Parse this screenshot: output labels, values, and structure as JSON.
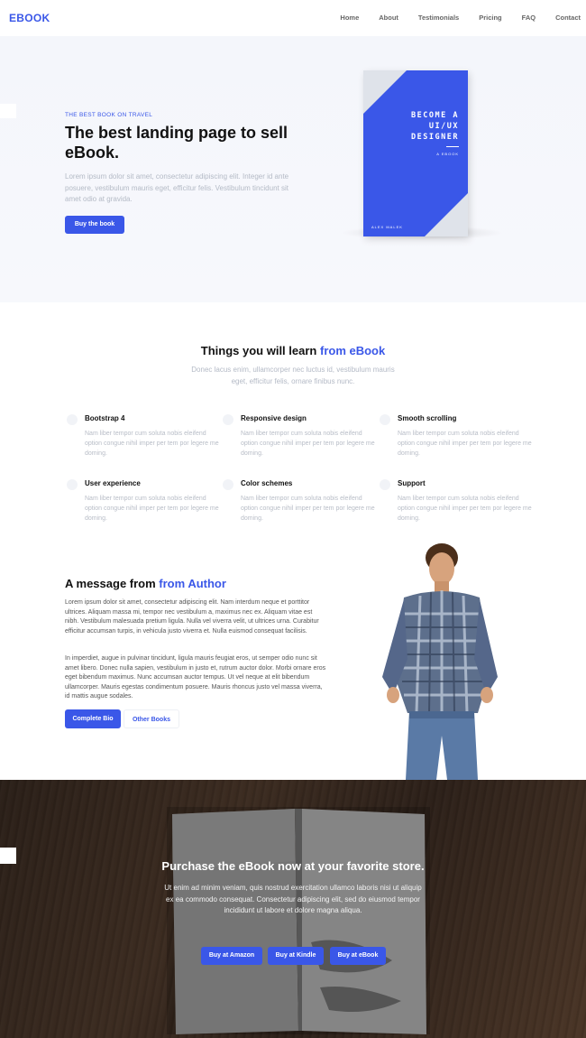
{
  "brand": {
    "logo": "EBOOK",
    "accent": "#3a57e8"
  },
  "nav": [
    "Home",
    "About",
    "Testimonials",
    "Pricing",
    "FAQ",
    "Contact"
  ],
  "hero": {
    "kicker": "THE BEST BOOK ON TRAVEL",
    "title": "The best landing page to sell eBook.",
    "text": "Lorem ipsum dolor sit amet, consectetur adipiscing elit. Integer id ante posuere, vestibulum mauris eget, efficitur felis. Vestibulum tincidunt sit amet odio at gravida.",
    "button": "Buy the book",
    "book": {
      "title": "BECOME A UI/UX DESIGNER",
      "subtitle": "A EBOOK",
      "author": "ALEX MALEK"
    }
  },
  "learn": {
    "title_prefix": "Things you will learn",
    "title_accent": "from eBook",
    "subtitle": "Donec lacus enim, ullamcorper nec luctus id, vestibulum mauris eget, efficitur felis, ornare finibus nunc.",
    "features": [
      {
        "title": "Bootstrap 4",
        "text": "Nam liber tempor cum soluta nobis eleifend option congue nihil imper per tem por legere me doming."
      },
      {
        "title": "Responsive design",
        "text": "Nam liber tempor cum soluta nobis eleifend option congue nihil imper per tem por legere me doming."
      },
      {
        "title": "Smooth scrolling",
        "text": "Nam liber tempor cum soluta nobis eleifend option congue nihil imper per tem por legere me doming."
      },
      {
        "title": "User experience",
        "text": "Nam liber tempor cum soluta nobis eleifend option congue nihil imper per tem por legere me doming."
      },
      {
        "title": "Color schemes",
        "text": "Nam liber tempor cum soluta nobis eleifend option congue nihil imper per tem por legere me doming."
      },
      {
        "title": "Support",
        "text": "Nam liber tempor cum soluta nobis eleifend option congue nihil imper per tem por legere me doming."
      }
    ]
  },
  "author": {
    "title_prefix": "A message from",
    "title_accent": "from Author",
    "paragraph1": "Lorem ipsum dolor sit amet, consectetur adipiscing elit. Nam interdum neque et porttitor ultrices. Aliquam massa mi, tempor nec vestibulum a, maximus nec ex. Aliquam vitae est nibh. Vestibulum malesuada pretium ligula. Nulla vel viverra velit, ut ultrices urna. Curabitur efficitur accumsan turpis, in vehicula justo viverra et. Nulla euismod consequat facilisis.",
    "paragraph2": "In imperdiet, augue in pulvinar tincidunt, ligula mauris feugiat eros, ut semper odio nunc sit amet libero. Donec nulla sapien, vestibulum in justo et, rutrum auctor dolor. Morbi ornare eros eget bibendum maximus. Nunc accumsan auctor tempus. Ut vel neque at elit bibendum ullamcorper. Mauris egestas condimentum posuere. Mauris rhoncus justo vel massa viverra, id mattis augue sodales.",
    "btn_complete": "Complete Bio",
    "btn_other": "Other Books"
  },
  "purchase": {
    "title": "Purchase the eBook now at your favorite store.",
    "text": "Ut enim ad minim veniam, quis nostrud exercitation ullamco laboris nisi ut aliquip ex ea commodo consequat. Consectetur adipiscing elit, sed do eiusmod tempor incididunt ut labore et dolore magna aliqua.",
    "buttons": [
      "Buy at Amazon",
      "Buy at Kindle",
      "Buy at eBook"
    ]
  }
}
